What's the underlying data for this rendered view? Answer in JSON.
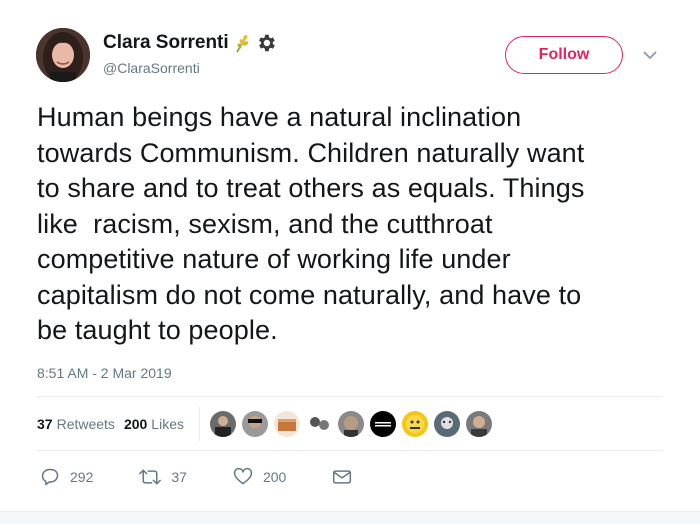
{
  "author": {
    "name": "Clara Sorrenti",
    "handle": "@ClaraSorrenti",
    "badges": [
      "wheat-icon",
      "gear-icon"
    ]
  },
  "follow_button": {
    "label": "Follow"
  },
  "tweet": {
    "text": "Human beings have a natural inclination\ntowards Communism. Children naturally want\nto share and to treat others as equals. Things\nlike  racism, sexism, and the cutthroat\ncompetitive nature of working life under\ncapitalism do not come naturally, and have to\nbe taught to people.",
    "timestamp": "8:51 AM - 2 Mar 2019"
  },
  "stats": {
    "retweets_count": "37",
    "retweets_label": "Retweets",
    "likes_count": "200",
    "likes_label": "Likes",
    "liker_avatars": 9
  },
  "actions": {
    "replies": "292",
    "retweets": "37",
    "likes": "200"
  },
  "colors": {
    "accent": "#e0245e",
    "muted": "#657786",
    "text": "#14171a",
    "divider": "#e6ecf0"
  }
}
